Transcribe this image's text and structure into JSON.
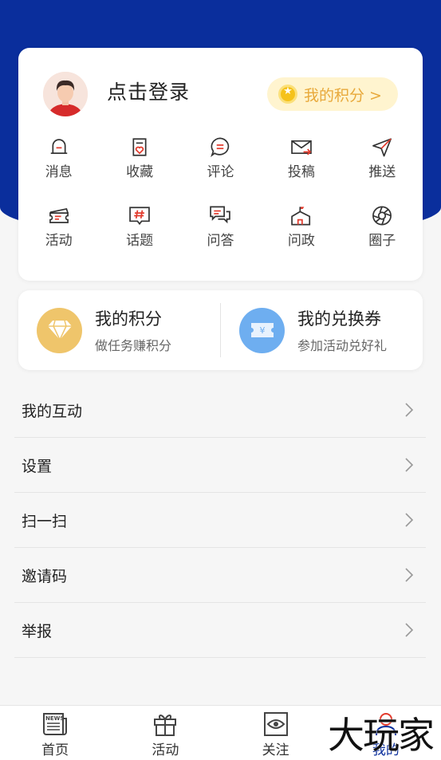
{
  "profile": {
    "login_text": "点击登录",
    "points_pill": "我的积分 >"
  },
  "grid": [
    {
      "label": "消息",
      "icon": "bell-icon"
    },
    {
      "label": "收藏",
      "icon": "favorite-icon"
    },
    {
      "label": "评论",
      "icon": "comment-icon"
    },
    {
      "label": "投稿",
      "icon": "submit-mail-icon"
    },
    {
      "label": "推送",
      "icon": "send-icon"
    },
    {
      "label": "活动",
      "icon": "ticket-icon"
    },
    {
      "label": "话题",
      "icon": "topic-icon"
    },
    {
      "label": "问答",
      "icon": "qa-icon"
    },
    {
      "label": "问政",
      "icon": "government-icon"
    },
    {
      "label": "圈子",
      "icon": "circle-icon"
    }
  ],
  "benefits": [
    {
      "title": "我的积分",
      "subtitle": "做任务赚积分",
      "icon": "diamond-icon",
      "color": "#efc56b"
    },
    {
      "title": "我的兑换券",
      "subtitle": "参加活动兑好礼",
      "icon": "coupon-icon",
      "color": "#6eaef0"
    }
  ],
  "menu": [
    {
      "label": "我的互动"
    },
    {
      "label": "设置"
    },
    {
      "label": "扫一扫"
    },
    {
      "label": "邀请码"
    },
    {
      "label": "举报"
    }
  ],
  "tabs": [
    {
      "label": "首页",
      "icon": "news-icon"
    },
    {
      "label": "活动",
      "icon": "gift-icon"
    },
    {
      "label": "关注",
      "icon": "eye-icon"
    },
    {
      "label": "我的",
      "icon": "person-icon",
      "active": true
    }
  ],
  "watermark": "大玩家",
  "colors": {
    "primary": "#0a2e9c",
    "accent_red": "#e23a2c",
    "pill_bg": "#fff4cf",
    "pill_text": "#e8a93b"
  }
}
